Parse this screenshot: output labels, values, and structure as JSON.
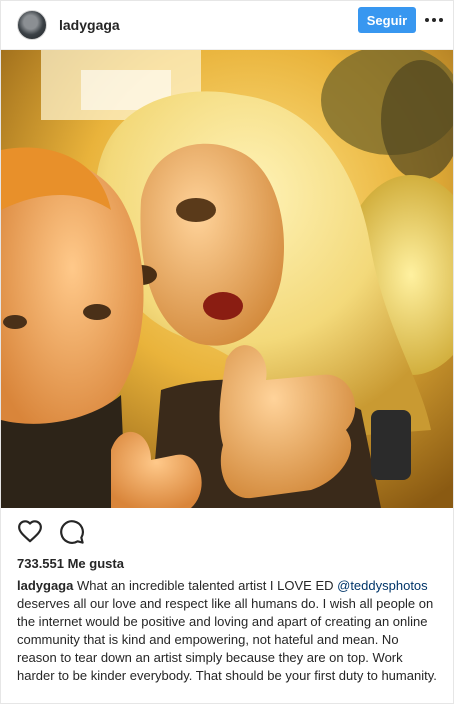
{
  "header": {
    "username": "ladygaga",
    "follow_label": "Seguir",
    "more_icon": "more-dots-icon"
  },
  "photo": {
    "description_icon": "post-photo"
  },
  "actions": {
    "like_icon": "heart-icon",
    "comment_icon": "comment-icon"
  },
  "likes_text": "733.551 Me gusta",
  "caption": {
    "username": "ladygaga",
    "text_part1": "What an incredible talented artist I LOVE ED",
    "mention": "@teddysphotos",
    "text_part2": "deserves all our love and respect like all humans do. I wish all people on the internet would be positive and loving and apart of creating an online community that is kind and empowering, not hateful and mean. No reason to tear down an artist simply because they are on top. Work harder to be kinder everybody. That should be your first duty to humanity."
  },
  "colors": {
    "follow_button": "#3897f0",
    "mention": "#003569",
    "text": "#262626"
  }
}
